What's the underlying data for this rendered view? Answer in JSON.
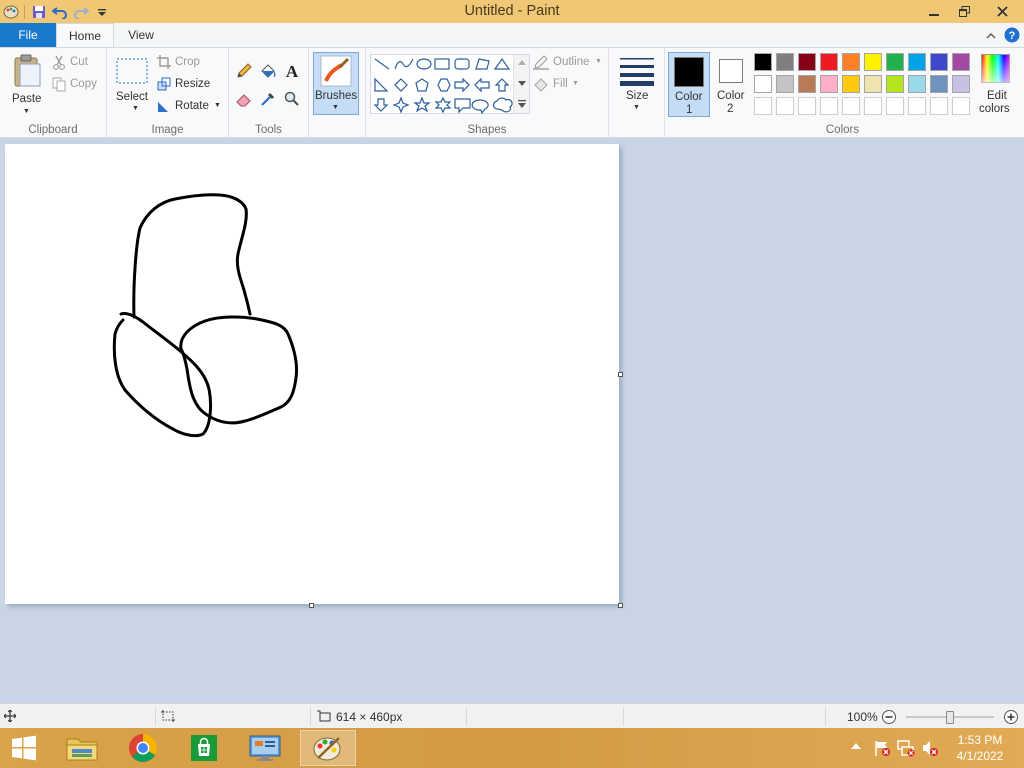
{
  "window": {
    "title": "Untitled - Paint",
    "controls": {
      "minimize": "—",
      "maximize": "❐",
      "close": "✕"
    }
  },
  "tabs": {
    "file": "File",
    "home": "Home",
    "view": "View"
  },
  "ribbon": {
    "clipboard": {
      "label": "Clipboard",
      "paste": "Paste",
      "cut": "Cut",
      "copy": "Copy"
    },
    "image": {
      "label": "Image",
      "select": "Select",
      "crop": "Crop",
      "resize": "Resize",
      "rotate": "Rotate"
    },
    "tools": {
      "label": "Tools"
    },
    "brushes": {
      "label": "Brushes"
    },
    "shapes": {
      "label": "Shapes",
      "outline": "Outline",
      "fill": "Fill"
    },
    "size": {
      "label": "Size"
    },
    "color1": {
      "line1": "Color",
      "line2": "1",
      "value": "#000000"
    },
    "color2": {
      "line1": "Color",
      "line2": "2",
      "value": "#ffffff"
    },
    "colors": {
      "label": "Colors",
      "row1": [
        "#000000",
        "#7f7f7f",
        "#880015",
        "#ed1c24",
        "#ff7f27",
        "#fff200",
        "#22b14c",
        "#00a2e8",
        "#3f48cc",
        "#a349a4"
      ],
      "row2": [
        "#ffffff",
        "#c3c3c3",
        "#b97a57",
        "#ffaec9",
        "#ffc90e",
        "#efe4b0",
        "#b5e61d",
        "#99d9ea",
        "#7092be",
        "#c8bfe7"
      ],
      "row3": [
        "#ffffff",
        "#ffffff",
        "#ffffff",
        "#ffffff",
        "#ffffff",
        "#ffffff",
        "#ffffff",
        "#ffffff",
        "#ffffff",
        "#ffffff"
      ]
    },
    "edit_colors": {
      "line1": "Edit",
      "line2": "colors"
    }
  },
  "status": {
    "canvas_size": "614 × 460px",
    "zoom": "100%",
    "zoom_slider_fraction": 0.5
  },
  "taskbar": {
    "time": "1:53 PM",
    "date": "4/1/2022",
    "apps": [
      "start",
      "file-explorer",
      "chrome",
      "store",
      "control-panel",
      "paint"
    ]
  },
  "accent": "#1979ca"
}
